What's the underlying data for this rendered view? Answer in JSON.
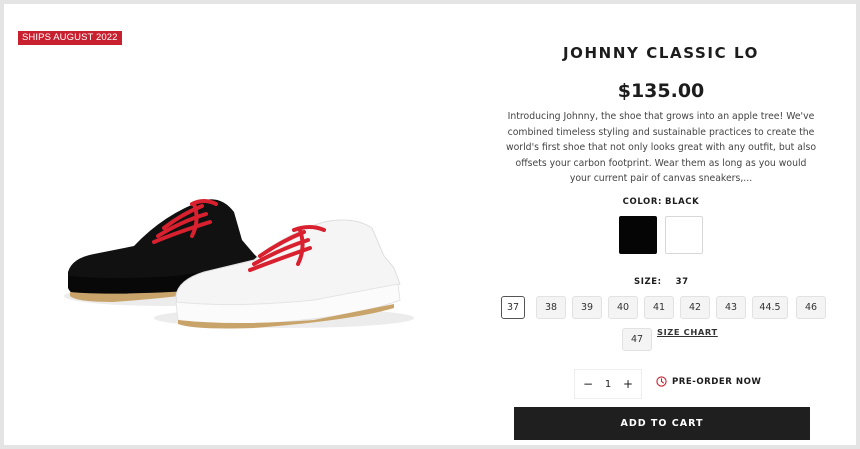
{
  "badge": {
    "label": "SHIPS AUGUST 2022"
  },
  "product": {
    "title": "JOHNNY CLASSIC LO",
    "price": "$135.00",
    "description": "Introducing Johnny, the shoe that grows into an apple tree! We've combined timeless styling and sustainable practices to create the world's first shoe that not only looks great with any outfit, but also offsets your carbon footprint. Wear them as long as you would your current pair of canvas sneakers,...",
    "image_icon": "sneaker-pair-image"
  },
  "color": {
    "label": "COLOR:",
    "selected": "BLACK",
    "options": [
      {
        "name": "black",
        "hex": "#050505"
      },
      {
        "name": "white",
        "hex": "#ffffff"
      }
    ]
  },
  "size": {
    "label": "SIZE:",
    "selected": "37",
    "options": [
      "37",
      "38",
      "39",
      "40",
      "41",
      "42",
      "43",
      "44.5",
      "46",
      "47"
    ],
    "chart_label": "SIZE CHART"
  },
  "quantity": {
    "minus": "−",
    "value": "1",
    "plus": "+"
  },
  "preorder": {
    "label": "PRE-ORDER NOW",
    "icon": "clock-icon",
    "color": "#c8202f"
  },
  "cart": {
    "label": "ADD TO CART"
  },
  "colors": {
    "accent": "#c8202f",
    "button": "#1f1f1f"
  }
}
